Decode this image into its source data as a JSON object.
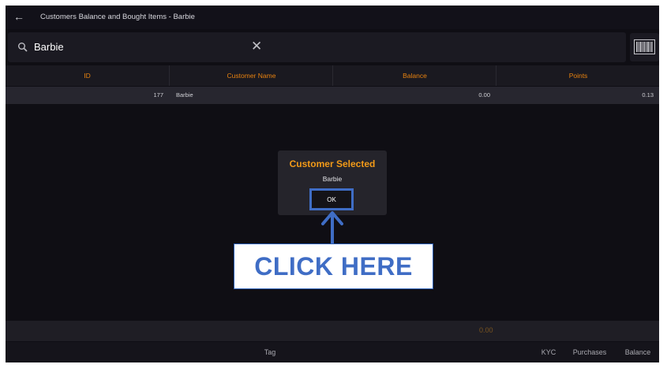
{
  "header": {
    "title": "Customers Balance and Bought Items - Barbie",
    "back_icon": "arrow-left-icon"
  },
  "search": {
    "value": "Barbie",
    "clear_label": "✕",
    "icon": "search-icon"
  },
  "barcode": {
    "icon": "barcode-icon"
  },
  "table": {
    "columns": [
      "ID",
      "Customer Name",
      "Balance",
      "Points"
    ],
    "rows": [
      {
        "id": "177",
        "name": "Barbie",
        "balance": "0.00",
        "points": "0.13"
      }
    ]
  },
  "dialog": {
    "title": "Customer Selected",
    "message": "Barbie",
    "ok_label": "OK"
  },
  "callout": {
    "text": "CLICK HERE"
  },
  "footer": {
    "total": "0.00"
  },
  "bottom_bar": {
    "tag_label": "Tag",
    "kyc_label": "KYC",
    "purchases_label": "Purchases",
    "balance_label": "Balance"
  },
  "colors": {
    "accent": "#e8820f",
    "highlight": "#3f6dc5",
    "background": "#0f0e14"
  }
}
